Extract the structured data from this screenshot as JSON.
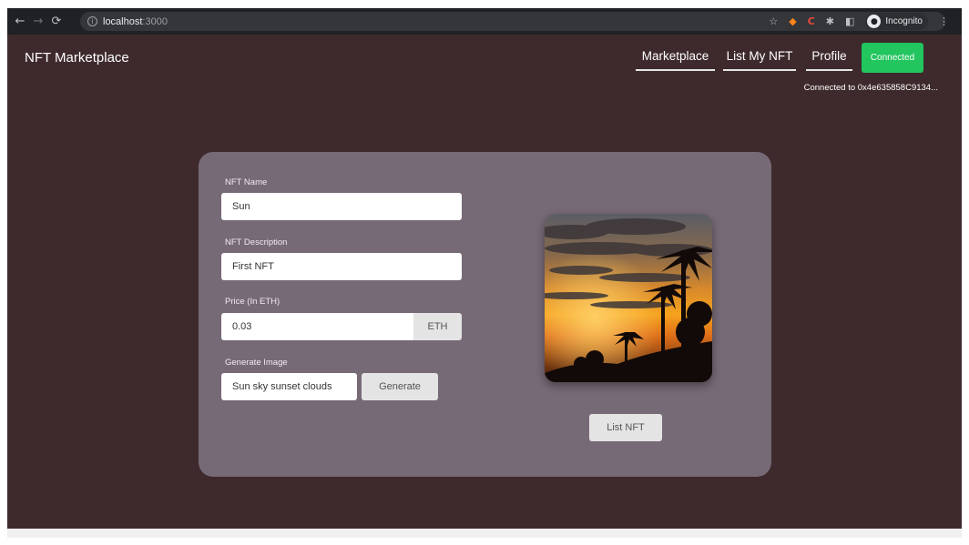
{
  "browser": {
    "url_host": "localhost",
    "url_port": ":3000",
    "incognito_label": "Incognito"
  },
  "app": {
    "brand": "NFT Marketplace",
    "nav": [
      {
        "label": "Marketplace"
      },
      {
        "label": "List My NFT"
      },
      {
        "label": "Profile"
      }
    ],
    "connect_button": "Connected",
    "connected_text": "Connected to 0x4e635858C9134...",
    "colors": {
      "background": "#3e2a2c",
      "card": "#776a77",
      "connect_button": "#22c55e"
    }
  },
  "form": {
    "name_label": "NFT Name",
    "name_value": "Sun",
    "description_label": "NFT Description",
    "description_value": "First NFT",
    "price_label": "Price (In ETH)",
    "price_value": "0.03",
    "price_unit": "ETH",
    "generate_label": "Generate Image",
    "generate_prompt": "Sun sky sunset clouds",
    "generate_button": "Generate",
    "list_button": "List NFT"
  }
}
